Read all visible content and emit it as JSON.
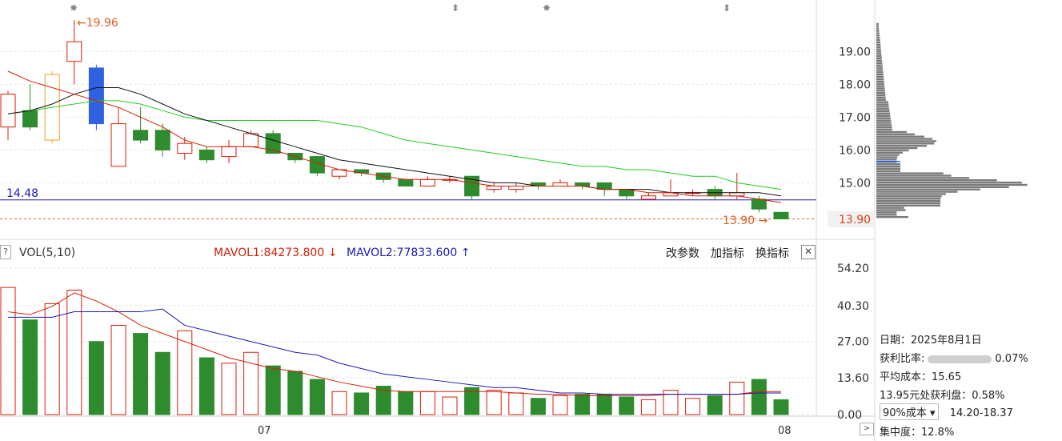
{
  "chart_data": [
    {
      "type": "candlestick",
      "ylim": [
        13.6,
        20.0
      ],
      "y_ticks": [
        "19.00",
        "18.00",
        "17.00",
        "16.00",
        "15.00"
      ],
      "last_price_label": "13.90",
      "high_label": "19.96",
      "low_label": "13.90",
      "ref_line_label": "14.48",
      "ref_line_value": 14.48,
      "candles": [
        {
          "o": 16.7,
          "c": 17.7,
          "h": 17.8,
          "l": 16.3
        },
        {
          "o": 17.2,
          "c": 16.7,
          "h": 18.0,
          "l": 16.6
        },
        {
          "o": 16.3,
          "c": 18.3,
          "h": 18.4,
          "l": 16.2
        },
        {
          "o": 18.7,
          "c": 19.3,
          "h": 19.96,
          "l": 18.0
        },
        {
          "o": 18.5,
          "c": 16.8,
          "h": 18.6,
          "l": 16.6
        },
        {
          "o": 15.5,
          "c": 16.8,
          "h": 17.3,
          "l": 15.5
        },
        {
          "o": 16.6,
          "c": 16.3,
          "h": 17.3,
          "l": 16.2
        },
        {
          "o": 16.6,
          "c": 16.0,
          "h": 16.8,
          "l": 15.8
        },
        {
          "o": 15.9,
          "c": 16.2,
          "h": 16.4,
          "l": 15.7
        },
        {
          "o": 16.0,
          "c": 15.7,
          "h": 16.1,
          "l": 15.6
        },
        {
          "o": 15.8,
          "c": 16.1,
          "h": 16.3,
          "l": 15.6
        },
        {
          "o": 16.1,
          "c": 16.5,
          "h": 16.6,
          "l": 16.1
        },
        {
          "o": 16.5,
          "c": 15.9,
          "h": 16.6,
          "l": 15.9
        },
        {
          "o": 15.9,
          "c": 15.7,
          "h": 15.9,
          "l": 15.6
        },
        {
          "o": 15.8,
          "c": 15.3,
          "h": 15.8,
          "l": 15.2
        },
        {
          "o": 15.2,
          "c": 15.4,
          "h": 15.4,
          "l": 15.1
        },
        {
          "o": 15.4,
          "c": 15.3,
          "h": 15.4,
          "l": 15.2
        },
        {
          "o": 15.3,
          "c": 15.1,
          "h": 15.3,
          "l": 15.0
        },
        {
          "o": 15.1,
          "c": 14.9,
          "h": 15.1,
          "l": 14.9
        },
        {
          "o": 14.9,
          "c": 15.1,
          "h": 15.2,
          "l": 14.9
        },
        {
          "o": 15.1,
          "c": 15.1,
          "h": 15.2,
          "l": 15.0
        },
        {
          "o": 15.2,
          "c": 14.6,
          "h": 15.2,
          "l": 14.5
        },
        {
          "o": 14.8,
          "c": 14.9,
          "h": 15.0,
          "l": 14.7
        },
        {
          "o": 14.8,
          "c": 14.9,
          "h": 15.0,
          "l": 14.7
        },
        {
          "o": 15.0,
          "c": 14.9,
          "h": 15.0,
          "l": 14.8
        },
        {
          "o": 14.9,
          "c": 15.0,
          "h": 15.1,
          "l": 14.9
        },
        {
          "o": 15.0,
          "c": 14.9,
          "h": 15.0,
          "l": 14.8
        },
        {
          "o": 15.0,
          "c": 14.8,
          "h": 15.0,
          "l": 14.6
        },
        {
          "o": 14.8,
          "c": 14.6,
          "h": 14.8,
          "l": 14.5
        },
        {
          "o": 14.5,
          "c": 14.6,
          "h": 14.7,
          "l": 14.5
        },
        {
          "o": 14.6,
          "c": 14.7,
          "h": 15.1,
          "l": 14.6
        },
        {
          "o": 14.7,
          "c": 14.7,
          "h": 14.8,
          "l": 14.6
        },
        {
          "o": 14.8,
          "c": 14.6,
          "h": 14.9,
          "l": 14.5
        },
        {
          "o": 14.6,
          "c": 14.7,
          "h": 15.3,
          "l": 14.5
        },
        {
          "o": 14.5,
          "c": 14.2,
          "h": 14.6,
          "l": 14.1
        },
        {
          "o": 14.1,
          "c": 13.9,
          "h": 14.1,
          "l": 13.9
        }
      ],
      "ma_black": [
        17.1,
        17.2,
        17.4,
        17.7,
        17.9,
        17.9,
        17.7,
        17.4,
        17.1,
        16.9,
        16.7,
        16.5,
        16.3,
        16.1,
        15.9,
        15.7,
        15.6,
        15.5,
        15.4,
        15.3,
        15.2,
        15.1,
        15.0,
        15.0,
        14.9,
        14.9,
        14.9,
        14.8,
        14.8,
        14.8,
        14.7,
        14.7,
        14.7,
        14.7,
        14.7,
        14.6
      ],
      "ma_red": [
        18.4,
        18.1,
        17.9,
        17.7,
        17.5,
        17.3,
        17.0,
        16.7,
        16.3,
        16.1,
        16.1,
        16.1,
        16.0,
        15.8,
        15.6,
        15.4,
        15.3,
        15.2,
        15.1,
        15.1,
        15.1,
        15.0,
        14.9,
        14.9,
        14.9,
        14.9,
        14.9,
        14.8,
        14.8,
        14.7,
        14.7,
        14.6,
        14.6,
        14.6,
        14.5,
        14.4
      ],
      "ma_green": [
        17.1,
        17.2,
        17.3,
        17.4,
        17.5,
        17.5,
        17.4,
        17.2,
        17.0,
        16.9,
        16.9,
        16.9,
        16.9,
        16.9,
        16.9,
        16.8,
        16.7,
        16.5,
        16.3,
        16.2,
        16.1,
        16.0,
        15.9,
        15.8,
        15.7,
        15.6,
        15.5,
        15.5,
        15.4,
        15.4,
        15.3,
        15.2,
        15.2,
        15.0,
        14.9,
        14.8
      ]
    },
    {
      "type": "bar",
      "title": "VOL(5,10)",
      "ylim": [
        0,
        60
      ],
      "y_ticks": [
        "54.20",
        "40.30",
        "27.00",
        "13.60",
        "0.00"
      ],
      "x_tick_labels": [
        "07",
        "08"
      ],
      "series": [
        {
          "name": "MAVOL1:84273.800",
          "arrow": "↓",
          "color": "#d81e06"
        },
        {
          "name": "MAVOL2:77833.600",
          "arrow": "↑",
          "color": "#1a1ab8"
        }
      ],
      "volumes": [
        47,
        35,
        41,
        46,
        27,
        33,
        30,
        23,
        31,
        21,
        19,
        23,
        18,
        16,
        13,
        8.5,
        8,
        10.5,
        8.5,
        8.5,
        6.5,
        10,
        9,
        8,
        6,
        7,
        7.5,
        7.5,
        6.5,
        5.5,
        9,
        6,
        7,
        12,
        13,
        5.5
      ],
      "mavol1": [
        38,
        37,
        40,
        45,
        42,
        38,
        33,
        30,
        27,
        24,
        21,
        19,
        17,
        16,
        14,
        12,
        10.5,
        9,
        8.5,
        8.5,
        8.5,
        8.5,
        8.5,
        8,
        7.5,
        7.5,
        7,
        7,
        7,
        7,
        7.5,
        7.5,
        7.5,
        7.5,
        8.5,
        8.5
      ],
      "mavol2": [
        36,
        36,
        36,
        38,
        38,
        38,
        38,
        39,
        33,
        31,
        29,
        27,
        25,
        23,
        22,
        19,
        17,
        15,
        14,
        13,
        12,
        11,
        10,
        10,
        9,
        8,
        8,
        7.5,
        7.5,
        7.5,
        7.5,
        7.5,
        7.5,
        7.5,
        8,
        8
      ]
    }
  ],
  "volume_toolbar": {
    "modify_params": "改参数",
    "add_indicator": "加指标",
    "switch_indicator": "换指标",
    "close": "✕",
    "help": "?"
  },
  "cost_distribution": {
    "date": "日期：2025年8月1日",
    "profit_ratio_label": "获利比率:",
    "profit_ratio_value": "0.07%",
    "avg_cost": "平均成本：15.65",
    "profit_at_price": "13.95元处获利盘：0.58%",
    "cost_select": "90%成本",
    "cost_range": "14.20-18.37",
    "concentration": "集中度：12.8%"
  },
  "colors": {
    "up": "#d81e06",
    "down": "#2e8b2e",
    "highlight_blue": "#2e62e0",
    "highlight_orange": "#f0a020",
    "ref_line": "#1a1ab8",
    "grid": "#e6e6e6"
  }
}
